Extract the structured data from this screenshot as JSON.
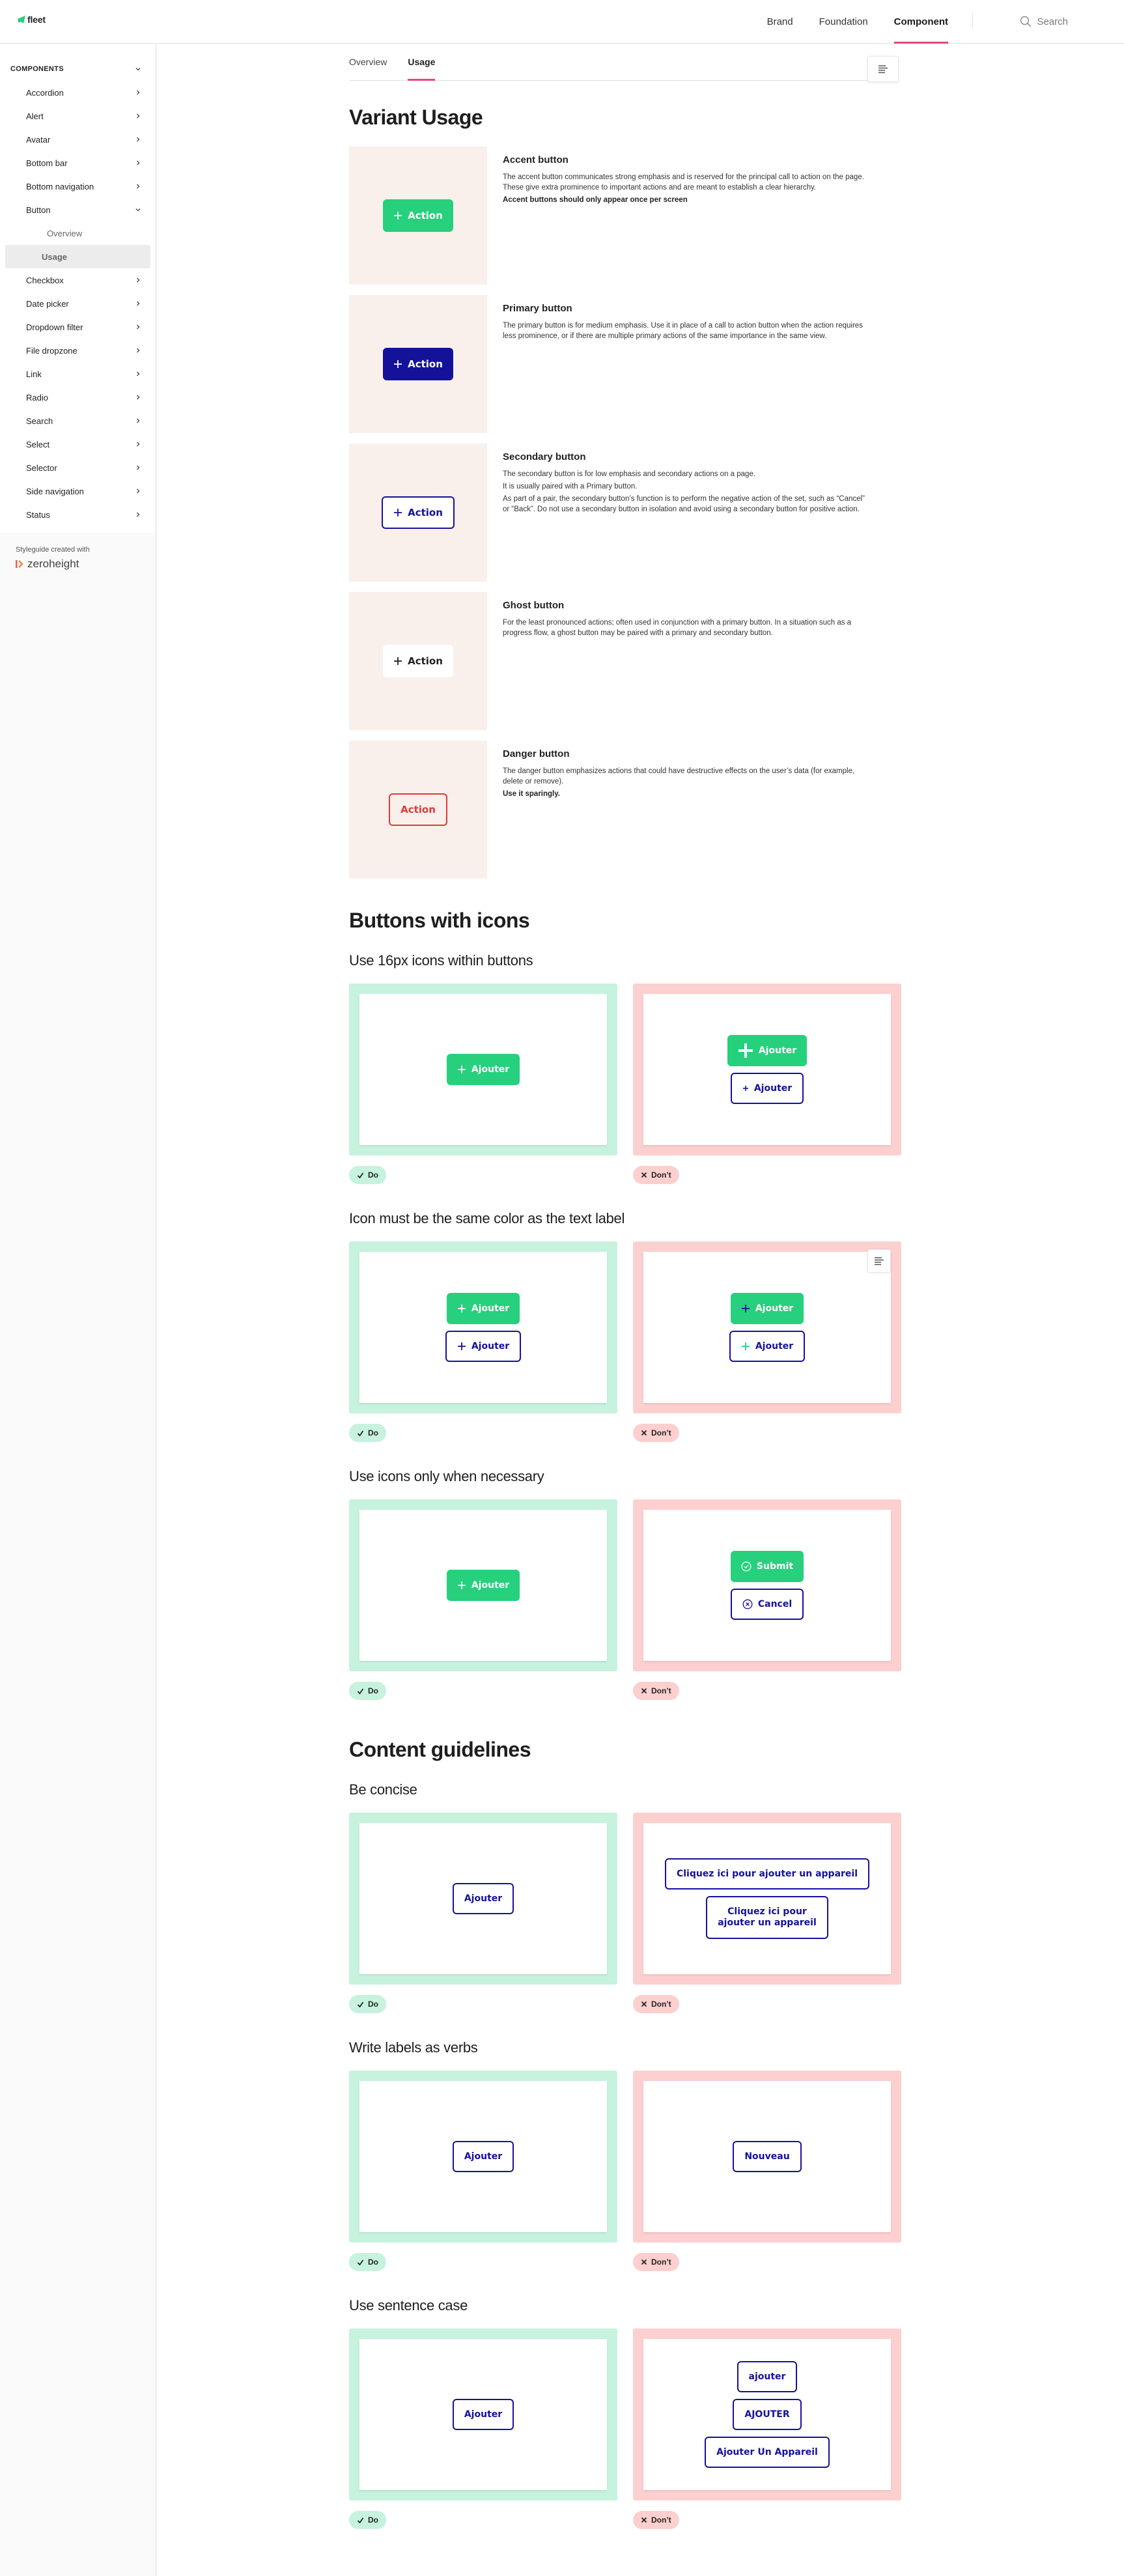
{
  "header": {
    "logo_text": "fleet",
    "nav": [
      {
        "label": "Brand",
        "active": false
      },
      {
        "label": "Foundation",
        "active": false
      },
      {
        "label": "Component",
        "active": true
      }
    ],
    "search_label": "Search"
  },
  "sidebar": {
    "section_label": "COMPONENTS",
    "items": [
      {
        "label": "Accordion"
      },
      {
        "label": "Alert"
      },
      {
        "label": "Avatar"
      },
      {
        "label": "Bottom bar"
      },
      {
        "label": "Bottom navigation"
      },
      {
        "label": "Button",
        "expanded": true,
        "children": [
          {
            "label": "Overview",
            "active": false
          },
          {
            "label": "Usage",
            "active": true
          }
        ]
      },
      {
        "label": "Checkbox"
      },
      {
        "label": "Date picker"
      },
      {
        "label": "Dropdown filter"
      },
      {
        "label": "File dropzone"
      },
      {
        "label": "Link"
      },
      {
        "label": "Radio"
      },
      {
        "label": "Search"
      },
      {
        "label": "Select"
      },
      {
        "label": "Selector"
      },
      {
        "label": "Side navigation"
      },
      {
        "label": "Status"
      }
    ],
    "footer_label": "Styleguide created with",
    "footer_brand": "zeroheight"
  },
  "tabs": [
    {
      "label": "Overview",
      "active": false
    },
    {
      "label": "Usage",
      "active": true
    }
  ],
  "variant_usage": {
    "title": "Variant Usage",
    "variants": [
      {
        "type": "accent",
        "button_label": "Action",
        "has_icon": true,
        "title": "Accent button",
        "paragraphs": [
          {
            "text": "The accent button communicates strong emphasis and is reserved for the principal call to action on the page. These give extra prominence to important actions and are meant to establish a clear hierarchy.",
            "bold": false
          },
          {
            "text": "Accent buttons should only appear once per screen",
            "bold": true
          }
        ]
      },
      {
        "type": "primary",
        "button_label": "Action",
        "has_icon": true,
        "title": "Primary button",
        "paragraphs": [
          {
            "text": "The primary button is for medium emphasis. Use it in place of a call to action button when the action requires less prominence, or if there are multiple primary actions of the same importance in the same view.",
            "bold": false
          }
        ]
      },
      {
        "type": "secondary",
        "button_label": "Action",
        "has_icon": true,
        "title": "Secondary button",
        "paragraphs": [
          {
            "text": "The secondary button is for low emphasis and secondary actions on a page.",
            "bold": false
          },
          {
            "text": "It is usually paired with a Primary button.",
            "bold": false
          },
          {
            "text": "As part of a pair, the secondary button’s function is to perform the negative action of the set, such as “Cancel” or “Back”. Do not use a secondary button in isolation and avoid using a secondary button for positive action.",
            "bold": false
          }
        ]
      },
      {
        "type": "ghost",
        "button_label": "Action",
        "has_icon": true,
        "title": "Ghost button",
        "paragraphs": [
          {
            "text": "For the least pronounced actions; often used in conjunction with a primary button. In a situation such as a progress flow, a ghost button may be paired with a primary and secondary button.",
            "bold": false
          }
        ]
      },
      {
        "type": "danger",
        "button_label": "Action",
        "has_icon": false,
        "title": "Danger button",
        "paragraphs": [
          {
            "text": "The danger button emphasizes actions that could have destructive effects on the user’s data (for example, delete or remove).",
            "bold": false
          },
          {
            "text": "Use it sparingly.",
            "bold": true
          }
        ]
      }
    ]
  },
  "badges": {
    "do": "Do",
    "dont": "Don’t"
  },
  "sections": [
    {
      "title": "Buttons with icons",
      "guidelines": [
        {
          "title": "Use 16px icons within buttons",
          "do": [
            {
              "style": "green",
              "label": "Ajouter",
              "icon": "plus",
              "icon_color": "#ffffff"
            }
          ],
          "dont": [
            {
              "style": "green",
              "label": "Ajouter",
              "icon": "plus-large",
              "icon_color": "#ffffff"
            },
            {
              "style": "outline",
              "label": "Ajouter",
              "icon": "plus-small",
              "icon_color": "#15129a"
            }
          ]
        },
        {
          "title": "Icon must be the same color as the text label",
          "do": [
            {
              "style": "green",
              "label": "Ajouter",
              "icon": "plus",
              "icon_color": "#ffffff"
            },
            {
              "style": "outline",
              "label": "Ajouter",
              "icon": "plus",
              "icon_color": "#15129a"
            }
          ],
          "dont": [
            {
              "style": "green",
              "label": "Ajouter",
              "icon": "plus",
              "icon_color": "#15129a"
            },
            {
              "style": "outline",
              "label": "Ajouter",
              "icon": "plus",
              "icon_color": "#26d07c"
            }
          ]
        },
        {
          "title": "Use icons only when necessary",
          "do": [
            {
              "style": "green",
              "label": "Ajouter",
              "icon": "plus",
              "icon_color": "#ffffff"
            }
          ],
          "dont": [
            {
              "style": "green",
              "label": "Submit",
              "icon": "check-circle",
              "icon_color": "#ffffff"
            },
            {
              "style": "outline",
              "label": "Cancel",
              "icon": "x-circle",
              "icon_color": "#15129a"
            }
          ]
        }
      ]
    },
    {
      "title": "Content guidelines",
      "guidelines": [
        {
          "title": "Be concise",
          "do": [
            {
              "style": "outline",
              "label": "Ajouter"
            }
          ],
          "dont": [
            {
              "style": "outline",
              "label": "Cliquez ici pour ajouter un appareil"
            },
            {
              "style": "outline-multi",
              "label": "Cliquez ici pour",
              "label2": "ajouter un appareil"
            }
          ]
        },
        {
          "title": "Write labels as verbs",
          "do": [
            {
              "style": "outline",
              "label": "Ajouter"
            }
          ],
          "dont": [
            {
              "style": "outline",
              "label": "Nouveau"
            }
          ]
        },
        {
          "title": "Use sentence case",
          "do": [
            {
              "style": "outline",
              "label": "Ajouter"
            }
          ],
          "dont": [
            {
              "style": "outline",
              "label": "ajouter"
            },
            {
              "style": "outline",
              "label": "AJOUTER"
            },
            {
              "style": "outline",
              "label": "Ajouter Un Appareil"
            }
          ]
        }
      ]
    }
  ],
  "colors": {
    "accent": "#26d07c",
    "primary": "#15129a",
    "danger": "#e0393b",
    "highlight": "#e8467c",
    "do_bg": "#c6f2de",
    "dont_bg": "#fdcfcf",
    "preview_bg": "#f9f0ec"
  }
}
